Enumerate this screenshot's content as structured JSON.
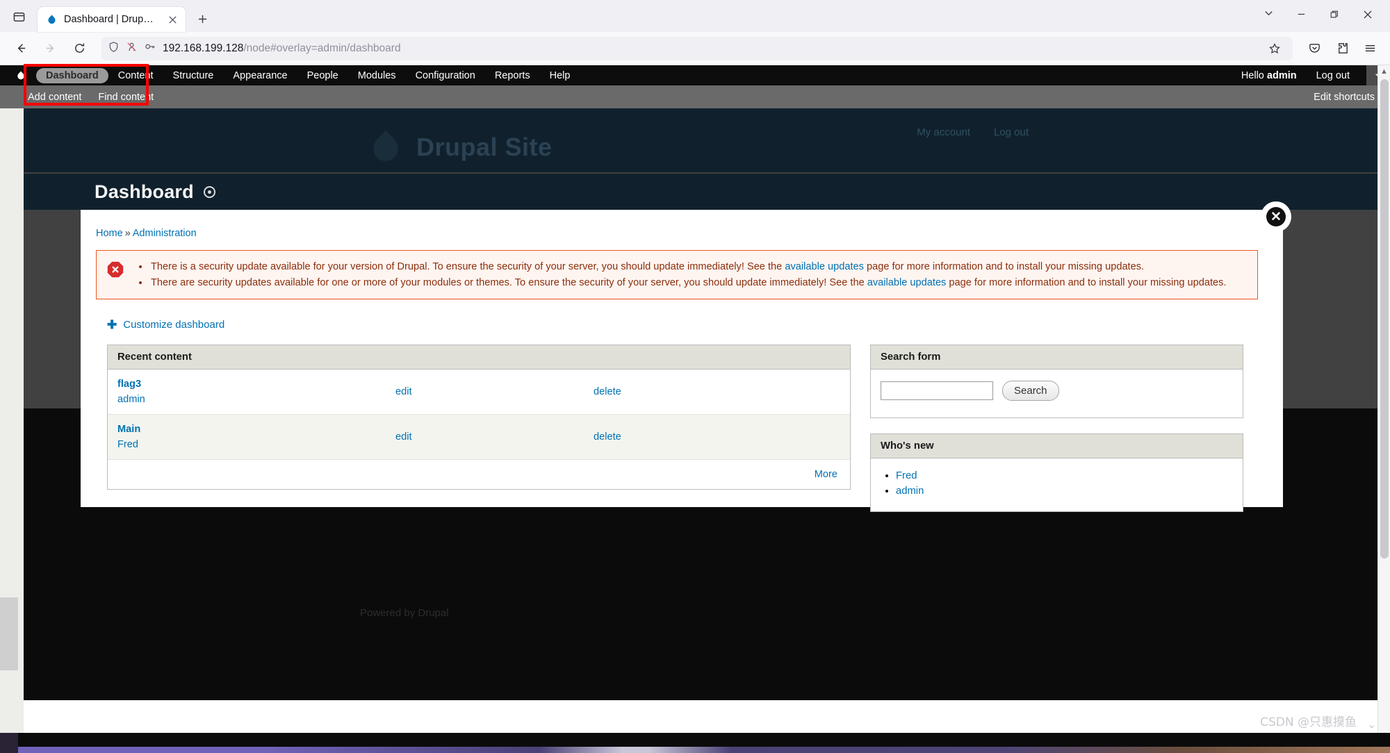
{
  "browser": {
    "tab": {
      "title": "Dashboard | Drupal Site",
      "favicon": "drupal-drop-icon",
      "close": "close-tab-icon"
    },
    "new_tab_label": "+",
    "url": {
      "host": "192.168.199.128",
      "path": "/node#overlay=admin/dashboard"
    },
    "toolbar_icons": {
      "firefox_view": "firefox-view-icon",
      "back": "back-arrow-icon",
      "forward": "forward-arrow-icon",
      "reload": "reload-icon",
      "shield": "tracking-protection-shield-icon",
      "permissions": "permissions-icon",
      "key": "saved-logins-key-icon",
      "bookmark": "bookmark-star-icon",
      "pocket": "pocket-icon",
      "extensions": "extensions-puzzle-icon",
      "app_menu": "hamburger-menu-icon",
      "tab_list": "list-all-tabs-chevron-icon",
      "minimize": "minimize-icon",
      "maximize": "maximize-icon",
      "close_window": "close-window-icon"
    }
  },
  "admin_toolbar": {
    "logo": "drupal-drop-icon",
    "items": [
      {
        "label": "Dashboard",
        "active": true
      },
      {
        "label": "Content",
        "active": false
      },
      {
        "label": "Structure",
        "active": false
      },
      {
        "label": "Appearance",
        "active": false
      },
      {
        "label": "People",
        "active": false
      },
      {
        "label": "Modules",
        "active": false
      },
      {
        "label": "Configuration",
        "active": false
      },
      {
        "label": "Reports",
        "active": false
      },
      {
        "label": "Help",
        "active": false
      }
    ],
    "greeting_prefix": "Hello ",
    "greeting_user": "admin",
    "logout": "Log out",
    "shortcut_toggle_icon": "chevron-down-icon"
  },
  "shortcut_bar": {
    "items": [
      {
        "label": "Add content"
      },
      {
        "label": "Find content"
      }
    ],
    "edit": "Edit shortcuts"
  },
  "site": {
    "name": "Drupal Site",
    "header_links": [
      {
        "label": "My account"
      },
      {
        "label": "Log out"
      }
    ],
    "footer": "Powered by Drupal"
  },
  "overlay": {
    "title": "Dashboard",
    "title_icon": "overlay-indicator-icon",
    "close_icon": "close-overlay-icon",
    "breadcrumb": [
      {
        "label": "Home"
      },
      {
        "label": "Administration"
      }
    ],
    "breadcrumb_separator": "»",
    "messages": {
      "type": "error",
      "icon": "error-x-icon",
      "items": [
        {
          "before": "There is a security update available for your version of Drupal. To ensure the security of your server, you should update immediately! See the ",
          "link": "available updates",
          "after": " page for more information and to install your missing updates."
        },
        {
          "before": "There are security updates available for one or more of your modules or themes. To ensure the security of your server, you should update immediately! See the ",
          "link": "available updates",
          "after": " page for more information and to install your missing updates."
        }
      ]
    },
    "customize_link": "Customize dashboard",
    "customize_icon": "plus-icon",
    "recent_content": {
      "title": "Recent content",
      "rows": [
        {
          "node": "flag3",
          "author": "admin",
          "edit": "edit",
          "delete": "delete"
        },
        {
          "node": "Main",
          "author": "Fred",
          "edit": "edit",
          "delete": "delete"
        }
      ],
      "more": "More"
    },
    "search_form": {
      "title": "Search form",
      "value": "",
      "placeholder": "",
      "button": "Search"
    },
    "whos_new": {
      "title": "Who's new",
      "users": [
        {
          "label": "Fred"
        },
        {
          "label": "admin"
        }
      ]
    }
  },
  "annotation": {
    "color": "#ff0000",
    "shape": "rectangle"
  },
  "watermark": {
    "text": "CSDN @只惠摸鱼"
  },
  "colors": {
    "accent_link": "#0071b3",
    "error_border": "#ed541d",
    "error_bg": "#fef5f1",
    "error_text": "#8c2e0b",
    "toolbar_bg": "#0d0d0d",
    "shortcut_bg": "#6a6a6a",
    "site_header_bg": "#10212d",
    "panel_title_bg": "#e0e0d8"
  }
}
